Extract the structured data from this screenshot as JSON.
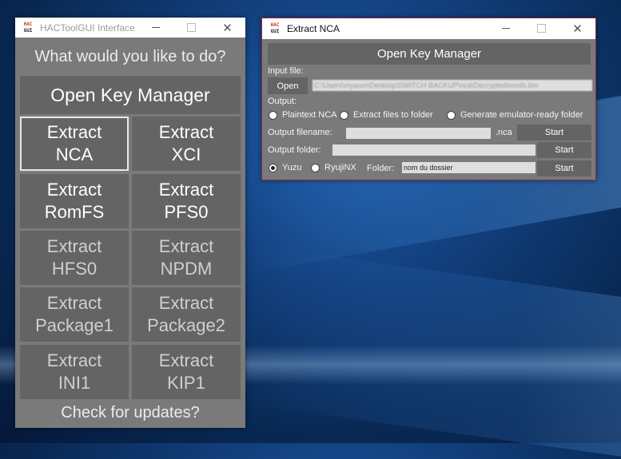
{
  "left_window": {
    "title": "HACToolGUI Interface",
    "logo_top": "HAC",
    "logo_bottom": "GUI",
    "prompt": "What would you like to do?",
    "open_key_manager": "Open Key Manager",
    "buttons": [
      {
        "line1": "Extract",
        "line2": "NCA"
      },
      {
        "line1": "Extract",
        "line2": "XCI"
      },
      {
        "line1": "Extract",
        "line2": "RomFS"
      },
      {
        "line1": "Extract",
        "line2": "PFS0"
      },
      {
        "line1": "Extract",
        "line2": "HFS0"
      },
      {
        "line1": "Extract",
        "line2": "NPDM"
      },
      {
        "line1": "Extract",
        "line2": "Package1"
      },
      {
        "line1": "Extract",
        "line2": "Package2"
      },
      {
        "line1": "Extract",
        "line2": "INI1"
      },
      {
        "line1": "Extract",
        "line2": "KIP1"
      }
    ],
    "check_updates": "Check for updates?"
  },
  "right_window": {
    "title": "Extract NCA",
    "logo_top": "HAC",
    "logo_bottom": "GUI",
    "open_key_manager": "Open Key Manager",
    "input_file_label": "Input file:",
    "open_button": "Open",
    "input_file_value": "C:\\Users\\myaum\\Desktop\\SWITCH BACKUP\\nca\\Decrypted\\romfs.bin",
    "output_label": "Output:",
    "output_options": {
      "plaintext": "Plaintext NCA",
      "extract_files": "Extract files to folder",
      "emulator_ready": "Generate emulator-ready folder"
    },
    "output_filename_label": "Output filename:",
    "output_filename_value": "",
    "nca_suffix": ".nca",
    "start_label": "Start",
    "output_folder_label": "Output folder:",
    "output_folder_value": "",
    "emulators": {
      "yuzu": "Yuzu",
      "ryujinx": "RyujiNX",
      "selected": "yuzu"
    },
    "folder_label": "Folder:",
    "folder_value": "nom du dossier"
  }
}
